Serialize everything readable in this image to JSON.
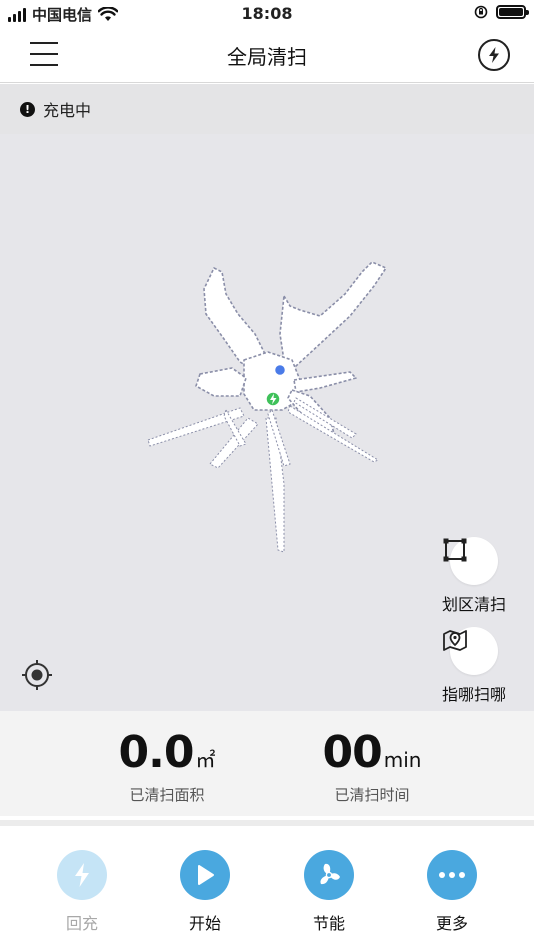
{
  "status_bar": {
    "carrier": "中国电信",
    "time": "18:08",
    "battery_level": 1.0
  },
  "nav": {
    "title": "全局清扫"
  },
  "notice": {
    "icon": "!",
    "text": "充电中"
  },
  "map_actions": {
    "zone_clean": "划区清扫",
    "spot_clean": "指哪扫哪"
  },
  "stats": {
    "area_value": "0.0",
    "area_unit": "㎡",
    "area_label": "已清扫面积",
    "time_value": "00",
    "time_unit": "min",
    "time_label": "已清扫时间"
  },
  "tabs": [
    {
      "label": "回充",
      "icon": "lightning-icon",
      "disabled": true
    },
    {
      "label": "开始",
      "icon": "play-icon",
      "disabled": false
    },
    {
      "label": "节能",
      "icon": "fan-icon",
      "disabled": false
    },
    {
      "label": "更多",
      "icon": "more-dots-icon",
      "disabled": false
    }
  ],
  "colors": {
    "accent": "#4aa8df",
    "accent_disabled": "#c5e4f6",
    "map_bg": "#e6e6ea",
    "robot": "#4a7be8",
    "dock": "#3fc15a"
  }
}
